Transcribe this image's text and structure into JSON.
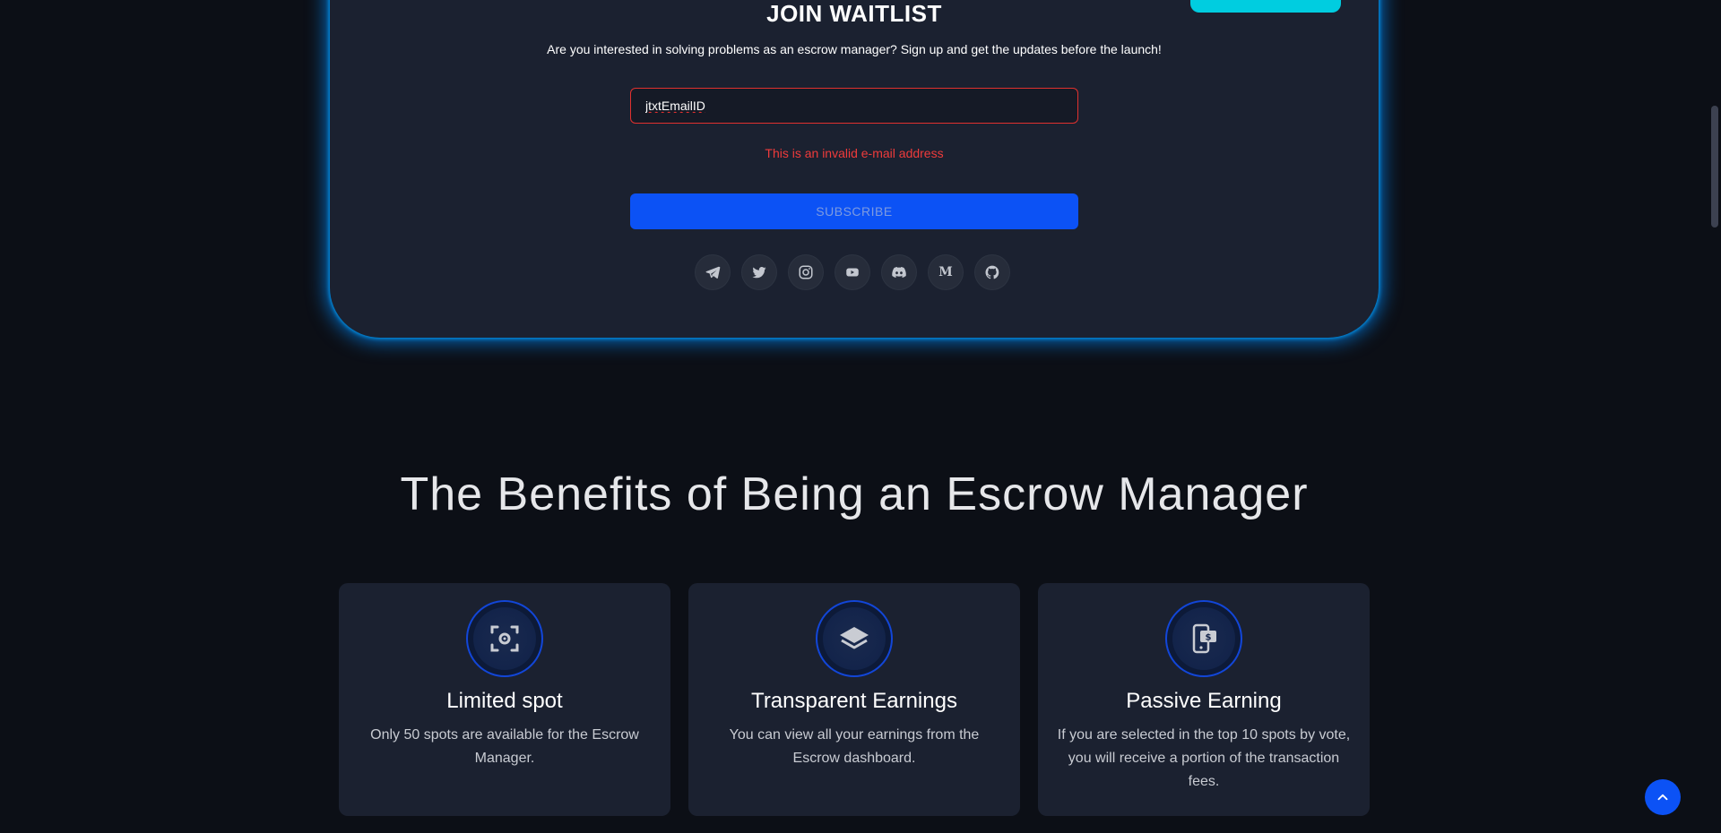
{
  "waitlist": {
    "title": "JOIN WAITLIST",
    "subtitle": "Are you interested in solving problems as an escrow manager? Sign up and get the updates before the launch!",
    "email_value": "jtxtEmailID",
    "error": "This is an invalid e-mail address",
    "subscribe_label": "SUBSCRIBE",
    "social": [
      {
        "name": "telegram-icon"
      },
      {
        "name": "twitter-icon"
      },
      {
        "name": "instagram-icon"
      },
      {
        "name": "youtube-icon"
      },
      {
        "name": "discord-icon"
      },
      {
        "name": "medium-icon",
        "glyph": "M"
      },
      {
        "name": "github-icon"
      }
    ]
  },
  "benefits": {
    "heading": "The Benefits of Being an Escrow Manager",
    "cards": [
      {
        "icon": "screenshot-target-icon",
        "title": "Limited spot",
        "text": "Only 50 spots are available for the Escrow Manager."
      },
      {
        "icon": "layers-icon",
        "title": "Transparent Earnings",
        "text": "You can view all your earnings from the Escrow dashboard."
      },
      {
        "icon": "mobile-payment-icon",
        "title": "Passive Earning",
        "text": "If you are selected in the top 10 spots by vote, you will receive a portion of the transaction fees."
      }
    ]
  },
  "colors": {
    "accent": "#0c52f5",
    "cyan": "#00cde0",
    "error": "#ef3b3b",
    "card": "#1b2130",
    "background": "#0c0f16"
  },
  "scroll_top": {
    "icon": "chevron-up-icon"
  }
}
